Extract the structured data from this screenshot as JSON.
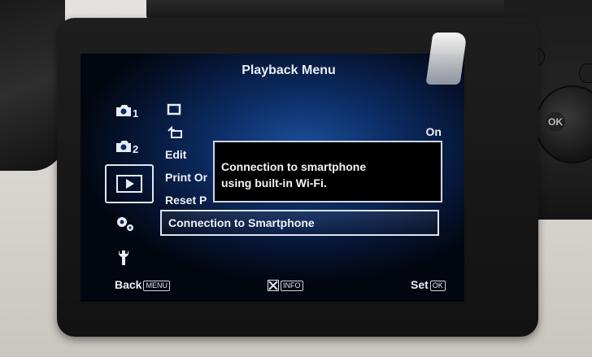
{
  "header": {
    "title": "Playback Menu"
  },
  "side_tabs": [
    {
      "icon": "camera-1-icon",
      "label": "1"
    },
    {
      "icon": "camera-2-icon",
      "label": "2"
    },
    {
      "icon": "playback-icon",
      "label": ""
    },
    {
      "icon": "custom-settings-icon",
      "label": ""
    },
    {
      "icon": "wrench-icon",
      "label": ""
    }
  ],
  "menu": {
    "items": [
      {
        "icon": "rotate-icon",
        "label": "",
        "value": ""
      },
      {
        "icon": "on-camera-display-icon",
        "label": "",
        "value": "On"
      },
      {
        "icon": "",
        "label": "Edit",
        "value": ""
      },
      {
        "icon": "",
        "label": "Print Or",
        "value": ""
      },
      {
        "icon": "",
        "label": "Reset P",
        "value": ""
      },
      {
        "icon": "",
        "label": "Connection to Smartphone",
        "value": ""
      }
    ],
    "selected_index": 5
  },
  "tooltip": {
    "line1": "Connection to smartphone",
    "line2": "using built-in Wi-Fi."
  },
  "footer": {
    "back_label": "Back",
    "back_key": "MENU",
    "info_key": "INFO",
    "set_label": "Set",
    "set_key": "OK"
  },
  "camera_body": {
    "dial_center_label": "OK"
  },
  "colors": {
    "screen_bg": "#0c2c63",
    "text": "#eef1f7",
    "highlight_border": "#dce3ee"
  }
}
